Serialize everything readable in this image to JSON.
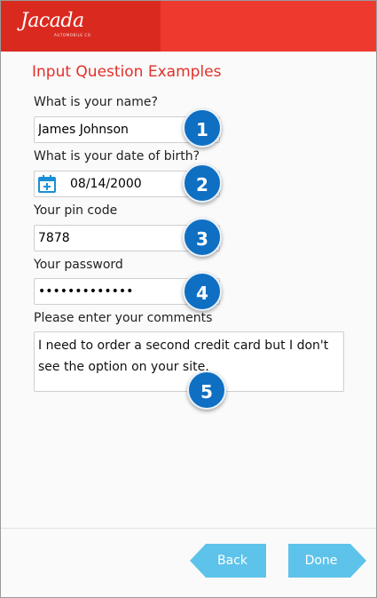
{
  "brand": {
    "logo_text": "Jacada",
    "logo_subtext": "AUTOMOBILE CO",
    "primary_color": "#ee3a2e",
    "accent_color": "#0f6fc2",
    "button_color": "#5ec3ea"
  },
  "page": {
    "title": "Input Question Examples"
  },
  "questions": [
    {
      "label": "What is your name?",
      "value": "James Johnson",
      "badge": "1"
    },
    {
      "label": "What is your date of birth?",
      "value": "08/14/2000",
      "badge": "2",
      "icon": "calendar-icon"
    },
    {
      "label": "Your pin code",
      "value": "7878",
      "badge": "3"
    },
    {
      "label": "Your password",
      "value": "•••••••••••••",
      "badge": "4"
    },
    {
      "label": "Please enter your comments",
      "value": "I need to order a second credit card but I don't see the option on your site.",
      "badge": "5"
    }
  ],
  "nav": {
    "back_label": "Back",
    "done_label": "Done"
  }
}
